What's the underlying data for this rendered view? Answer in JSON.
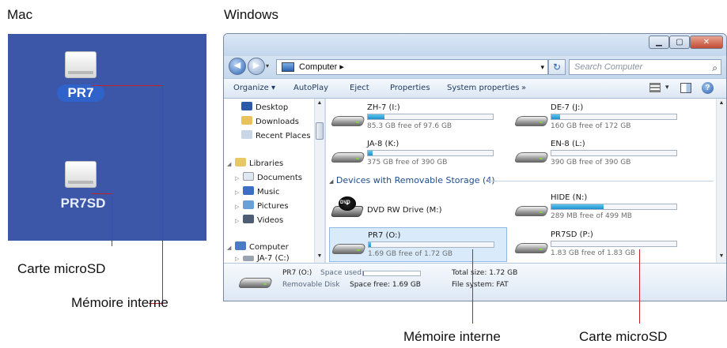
{
  "captions": {
    "mac": "Mac",
    "windows": "Windows",
    "mac_microsd": "Carte microSD",
    "mac_internal": "Mémoire interne",
    "win_internal": "Mémoire interne",
    "win_microsd": "Carte microSD"
  },
  "mac_panel": {
    "drives": [
      {
        "label": "PR7",
        "icon": "drive-icon"
      },
      {
        "label": "PR7SD",
        "icon": "drive-icon"
      }
    ],
    "background": "#3d57a8"
  },
  "explorer": {
    "address": {
      "path": "Computer ▸",
      "prefix": "▸"
    },
    "search_placeholder": "Search Computer",
    "toolbar": {
      "organize": "Organize ▾",
      "autoplay": "AutoPlay",
      "eject": "Eject",
      "properties": "Properties",
      "system_properties": "System properties",
      "more": "»"
    },
    "nav": {
      "desktop": "Desktop",
      "downloads": "Downloads",
      "recent_places": "Recent Places",
      "libraries": "Libraries",
      "documents": "Documents",
      "music": "Music",
      "pictures": "Pictures",
      "videos": "Videos",
      "computer": "Computer",
      "ja7": "JA-7 (C:)"
    },
    "hard_disks": [
      {
        "name": "ZH-7 (I:)",
        "free": "85.3 GB free of 97.6 GB",
        "used_fraction": 0.13
      },
      {
        "name": "DE-7 (J:)",
        "free": "160 GB free of 172 GB",
        "used_fraction": 0.07
      },
      {
        "name": "JA-8 (K:)",
        "free": "375 GB free of 390 GB",
        "used_fraction": 0.04
      },
      {
        "name": "EN-8 (L:)",
        "free": "390 GB free of 390 GB",
        "used_fraction": 0.0
      }
    ],
    "removable_section": "Devices with Removable Storage (4)",
    "removable": [
      {
        "name": "DVD RW Drive (M:)"
      },
      {
        "name": "HIDE (N:)",
        "free": "289 MB free of 499 MB",
        "used_fraction": 0.42
      },
      {
        "name": "PR7 (O:)",
        "free": "1.69 GB free of 1.72 GB",
        "used_fraction": 0.02
      },
      {
        "name": "PR7SD (P:)",
        "free": "1.83 GB free of 1.83 GB",
        "used_fraction": 0.0
      }
    ],
    "details": {
      "name": "PR7 (O:)",
      "type": "Removable Disk",
      "space_used_label": "Space used:",
      "space_free": "Space free: 1.69 GB",
      "total_size": "Total size: 1.72 GB",
      "file_system": "File system: FAT",
      "used_fraction": 0.02
    }
  },
  "colors": {
    "leader_line": "#c0242a",
    "bar_fill": "#1e8fcf"
  }
}
